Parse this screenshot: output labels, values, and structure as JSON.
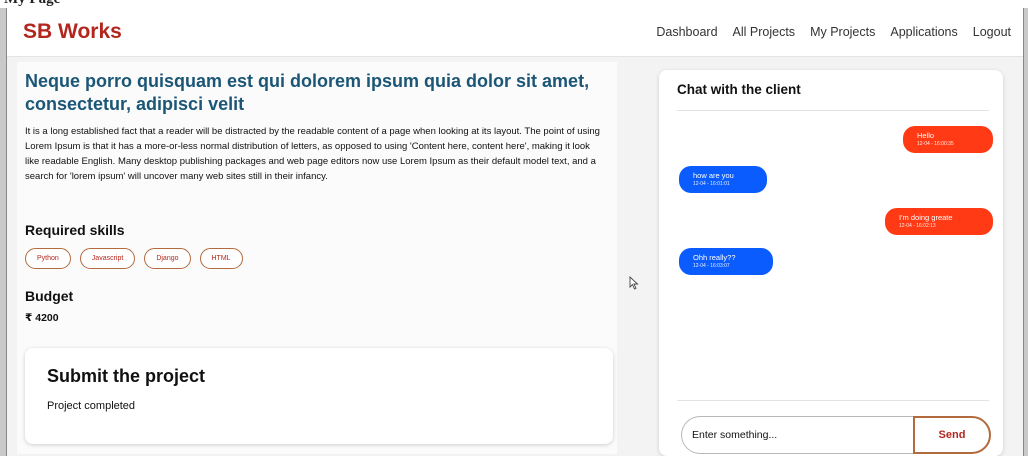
{
  "top_caption": "My Page",
  "navbar": {
    "logo": "SB Works",
    "links": [
      "Dashboard",
      "All Projects",
      "My Projects",
      "Applications",
      "Logout"
    ]
  },
  "project": {
    "title": "Neque porro quisquam est qui dolorem ipsum quia dolor sit amet, consectetur, adipisci velit",
    "description": "It is a long established fact that a reader will be distracted by the readable content of a page when looking at its layout. The point of using Lorem Ipsum is that it has a more-or-less normal distribution of letters, as opposed to using 'Content here, content here', making it look like readable English. Many desktop publishing packages and web page editors now use Lorem Ipsum as their default model text, and a search for 'lorem ipsum' will uncover many web sites still in their infancy.",
    "skills_heading": "Required skills",
    "skills": [
      "Python",
      "Javascript",
      "Django",
      "HTML"
    ],
    "budget_heading": "Budget",
    "budget_value": "₹ 4200"
  },
  "submit": {
    "title": "Submit the project",
    "status": "Project completed"
  },
  "chat": {
    "title": "Chat with the client",
    "messages": [
      {
        "text": "Hello",
        "time": "12-04 - 16:00:35",
        "direction": "out"
      },
      {
        "text": "how are you",
        "time": "12-04 - 16:01:01",
        "direction": "in"
      },
      {
        "text": "I'm doing greate",
        "time": "12-04 - 16:02:13",
        "direction": "out"
      },
      {
        "text": "Ohh really??",
        "time": "12-04 - 16:03:07",
        "direction": "in"
      }
    ],
    "input_placeholder": "Enter something...",
    "send_label": "Send"
  },
  "colors": {
    "brand": "#b3261e",
    "title_blue": "#1b5676",
    "outgoing_bubble": "#ff3a14",
    "incoming_bubble": "#0a5cff"
  }
}
